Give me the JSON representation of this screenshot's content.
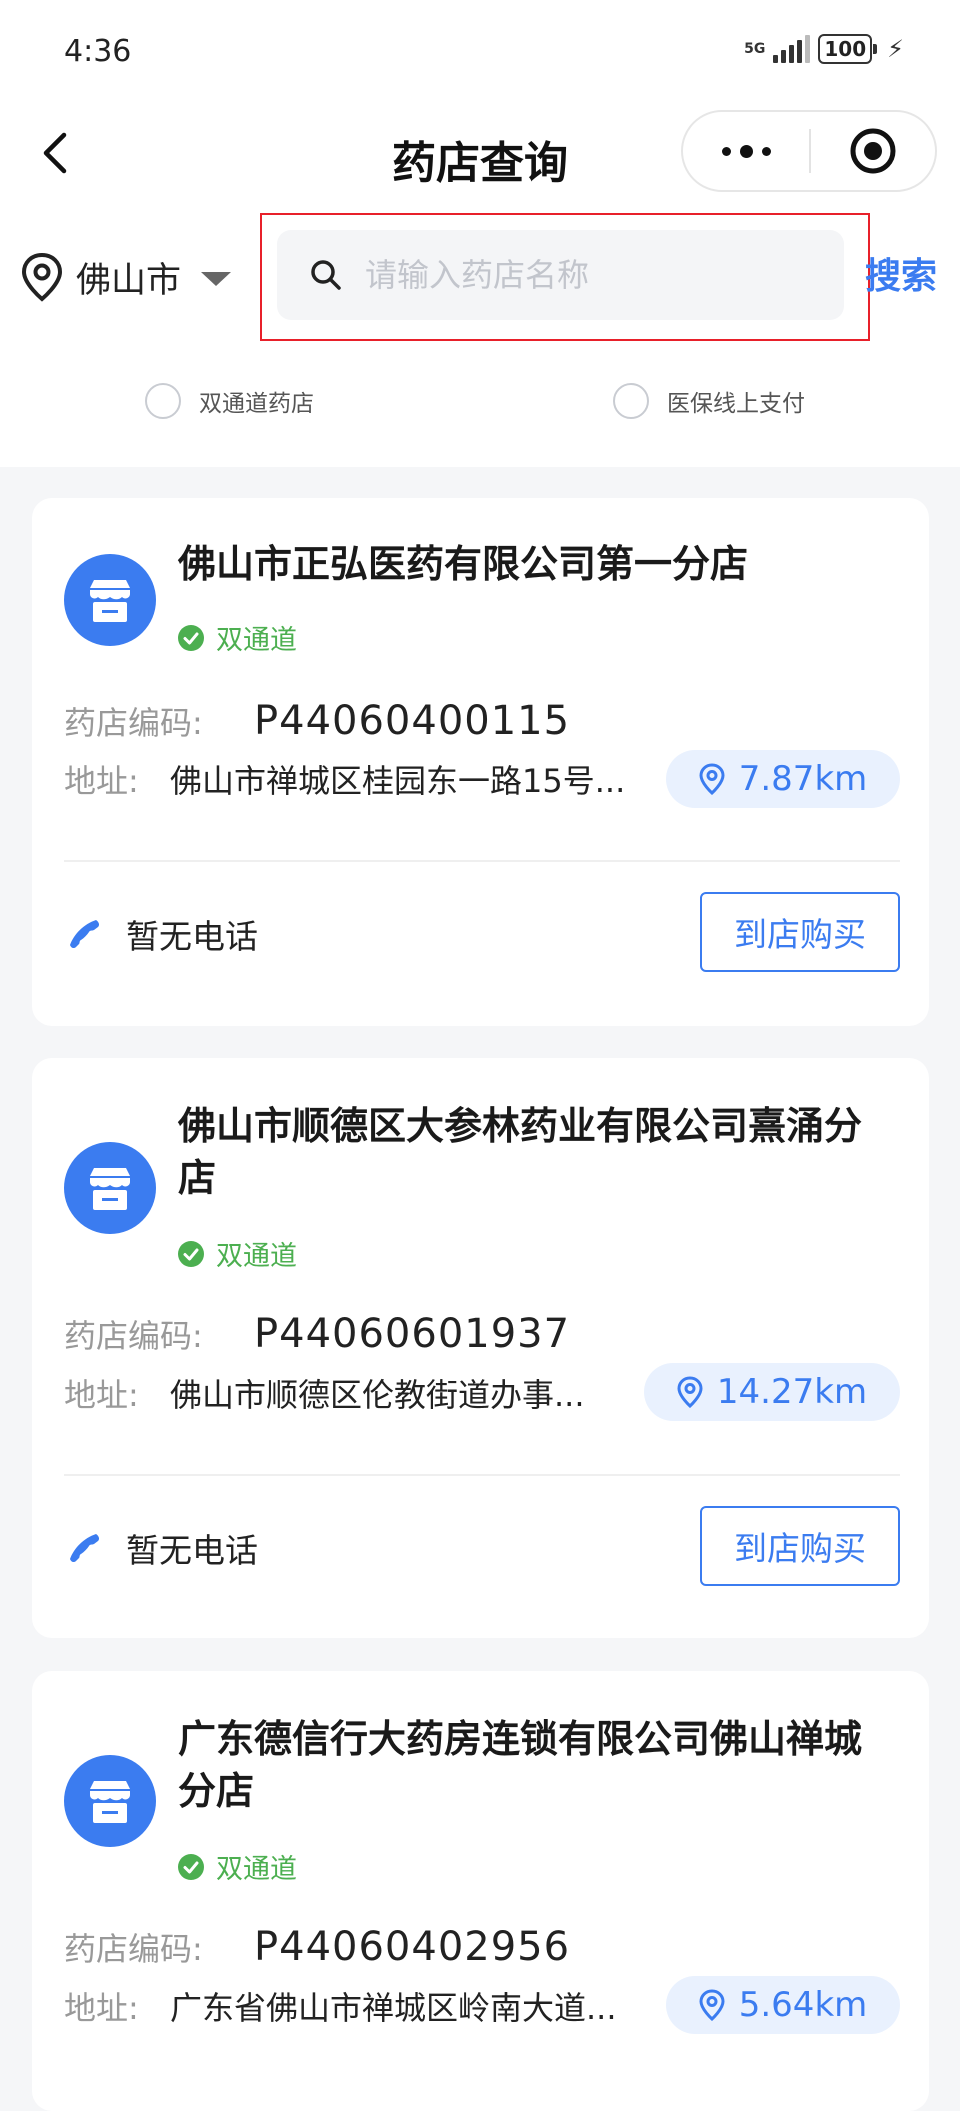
{
  "status_bar": {
    "time": "4:36",
    "network": "5G",
    "battery": "100"
  },
  "nav": {
    "title": "药店查询"
  },
  "search": {
    "city": "佛山市",
    "placeholder": "请输入药店名称",
    "value": "",
    "button_label": "搜索"
  },
  "filters": [
    {
      "label": "双通道药店",
      "checked": false
    },
    {
      "label": "医保线上支付",
      "checked": false
    }
  ],
  "pharmacies": [
    {
      "name": "佛山市正弘医药有限公司第一分店",
      "tag": "双通道",
      "code_label": "药店编码:",
      "code": "P44060400115",
      "address_label": "地址:",
      "address": "佛山市禅城区桂园东一路15号...",
      "distance": "7.87km",
      "phone": "暂无电话",
      "action_label": "到店购买"
    },
    {
      "name": "佛山市顺德区大参林药业有限公司熹涌分店",
      "tag": "双通道",
      "code_label": "药店编码:",
      "code": "P44060601937",
      "address_label": "地址:",
      "address": "佛山市顺德区伦教街道办事...",
      "distance": "14.27km",
      "phone": "暂无电话",
      "action_label": "到店购买"
    },
    {
      "name": "广东德信行大药房连锁有限公司佛山禅城分店",
      "tag": "双通道",
      "code_label": "药店编码:",
      "code": "P44060402956",
      "address_label": "地址:",
      "address": "广东省佛山市禅城区岭南大道...",
      "distance": "5.64km",
      "phone": "",
      "action_label": ""
    }
  ],
  "colors": {
    "accent": "#3b7cf0",
    "tag_green": "#4caf50",
    "highlight_red": "#e8202a",
    "distance_bg": "#e9f1fe"
  },
  "icons": {
    "back": "chevron-left-icon",
    "more": "more-dots-icon",
    "close": "target-circle-icon",
    "location": "location-pin-icon",
    "search": "search-icon",
    "shop": "store-icon",
    "verified": "check-circle-icon",
    "phone": "phone-icon"
  }
}
